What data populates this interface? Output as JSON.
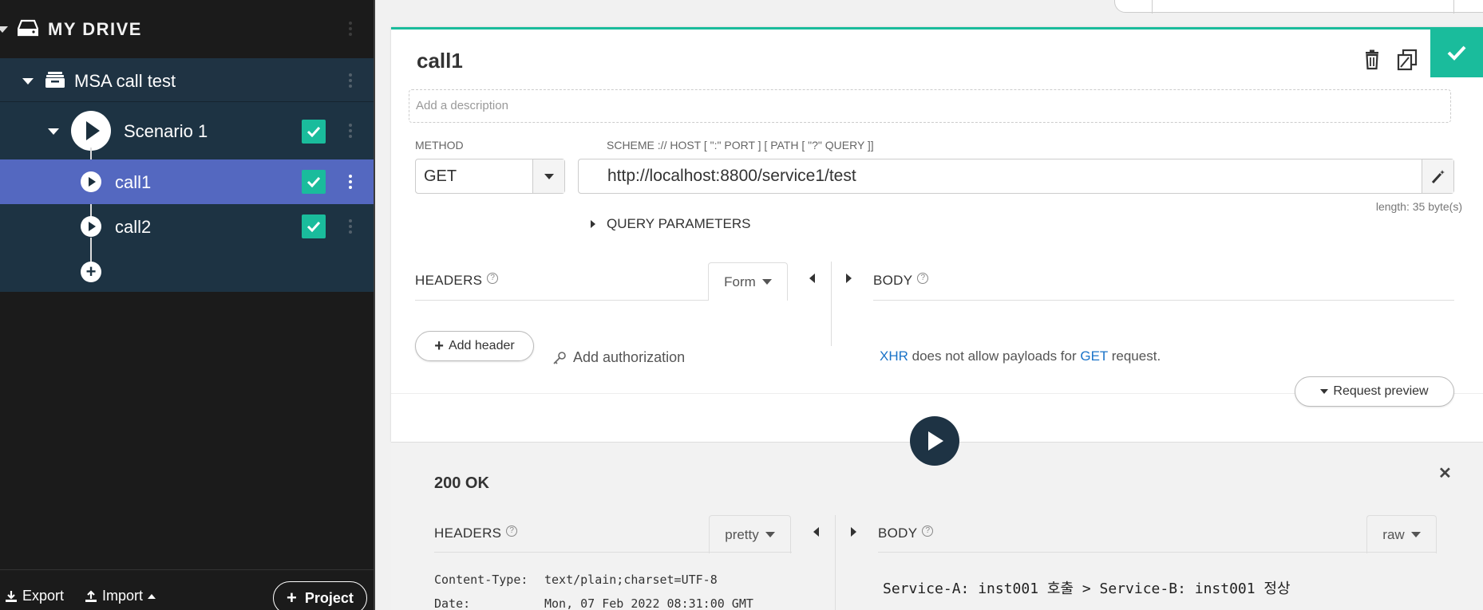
{
  "sidebar": {
    "drive_title": "MY DRIVE",
    "project": {
      "label": "MSA call test"
    },
    "scenario": {
      "label": "Scenario 1"
    },
    "calls": [
      {
        "label": "call1"
      },
      {
        "label": "call2"
      }
    ],
    "footer": {
      "export_label": "Export",
      "import_label": "Import",
      "project_label": "Project"
    }
  },
  "request": {
    "name": "call1",
    "description_placeholder": "Add a description",
    "method_label": "METHOD",
    "method_value": "GET",
    "url_label": "SCHEME :// HOST [ \":\" PORT ] [ PATH [ \"?\" QUERY ]]",
    "url_value": "http://localhost:8800/service1/test",
    "length_text": "length: 35 byte(s)",
    "query_params_label": "QUERY PARAMETERS",
    "headers_label": "HEADERS",
    "headers_mode": "Form",
    "body_label": "BODY",
    "add_header_label": "Add header",
    "add_authorization_label": "Add authorization",
    "body_note_xhr": "XHR",
    "body_note_mid": " does not allow payloads for ",
    "body_note_get": "GET",
    "body_note_end": " request.",
    "request_preview_label": "Request preview"
  },
  "response": {
    "status": "200 OK",
    "headers_label": "HEADERS",
    "headers_mode": "pretty",
    "body_label": "BODY",
    "body_mode": "raw",
    "header_lines": [
      {
        "key": "Content-Type:",
        "value": "text/plain;charset=UTF-8"
      },
      {
        "key": "Date:",
        "value": "Mon, 07 Feb 2022 08:31:00 GMT"
      }
    ],
    "body_text": "Service-A: inst001 호출 > Service-B: inst001 정상"
  },
  "colors": {
    "accent": "#1abc9c",
    "selected_row": "#5468c0",
    "sidebar_bg": "#1b1b1b",
    "tree_bg": "#1d3343",
    "link": "#1a73c8"
  }
}
